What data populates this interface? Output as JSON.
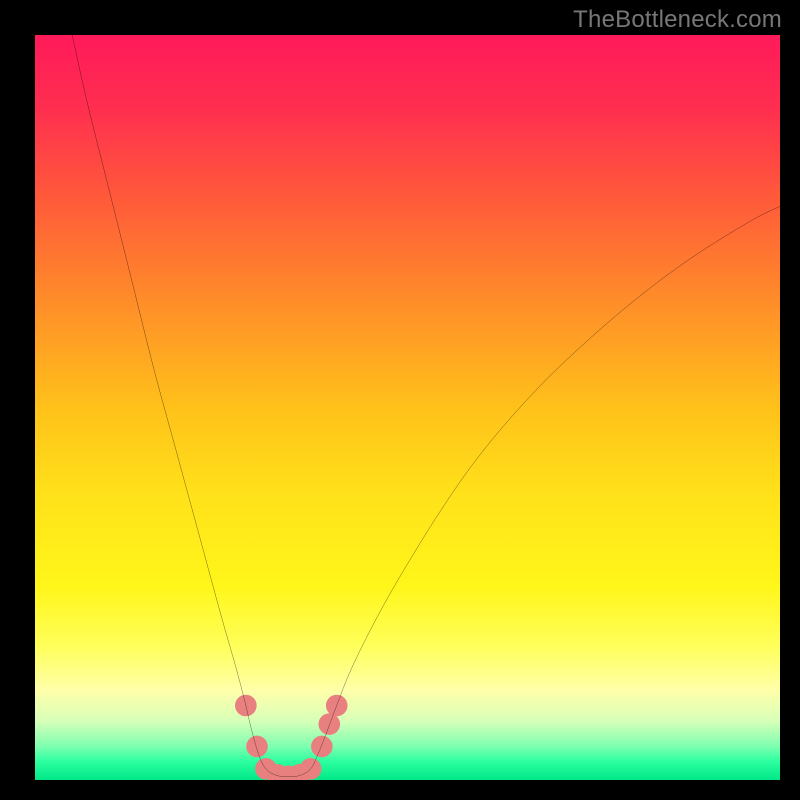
{
  "watermark": {
    "text": "TheBottleneck.com"
  },
  "gradient": {
    "stops": [
      {
        "offset": 0.0,
        "color": "#ff1a5a"
      },
      {
        "offset": 0.1,
        "color": "#ff2f4f"
      },
      {
        "offset": 0.22,
        "color": "#ff5a3a"
      },
      {
        "offset": 0.35,
        "color": "#ff8a2a"
      },
      {
        "offset": 0.5,
        "color": "#ffc11a"
      },
      {
        "offset": 0.62,
        "color": "#ffe21a"
      },
      {
        "offset": 0.74,
        "color": "#fff61a"
      },
      {
        "offset": 0.82,
        "color": "#ffff5a"
      },
      {
        "offset": 0.88,
        "color": "#ffffaa"
      },
      {
        "offset": 0.92,
        "color": "#d8ffb8"
      },
      {
        "offset": 0.955,
        "color": "#7dffb0"
      },
      {
        "offset": 0.975,
        "color": "#2dffa0"
      },
      {
        "offset": 1.0,
        "color": "#00e888"
      }
    ]
  },
  "chart_data": {
    "type": "line",
    "title": "",
    "xlabel": "",
    "ylabel": "",
    "xlim": [
      0,
      100
    ],
    "ylim": [
      0,
      100
    ],
    "series": [
      {
        "name": "bottleneck-curve",
        "style": "thin-black",
        "points": [
          {
            "x": 5.0,
            "y": 100.0
          },
          {
            "x": 7.0,
            "y": 91.0
          },
          {
            "x": 10.0,
            "y": 79.0
          },
          {
            "x": 13.0,
            "y": 67.0
          },
          {
            "x": 16.0,
            "y": 55.0
          },
          {
            "x": 19.0,
            "y": 44.0
          },
          {
            "x": 22.0,
            "y": 33.0
          },
          {
            "x": 25.0,
            "y": 22.0
          },
          {
            "x": 27.0,
            "y": 15.0
          },
          {
            "x": 28.3,
            "y": 10.0
          },
          {
            "x": 29.0,
            "y": 7.0
          },
          {
            "x": 30.0,
            "y": 3.5
          },
          {
            "x": 31.0,
            "y": 1.5
          },
          {
            "x": 32.5,
            "y": 0.6
          },
          {
            "x": 34.0,
            "y": 0.5
          },
          {
            "x": 35.5,
            "y": 0.6
          },
          {
            "x": 37.0,
            "y": 1.5
          },
          {
            "x": 38.0,
            "y": 3.5
          },
          {
            "x": 39.0,
            "y": 6.0
          },
          {
            "x": 40.5,
            "y": 10.0
          },
          {
            "x": 42.5,
            "y": 15.0
          },
          {
            "x": 46.0,
            "y": 22.0
          },
          {
            "x": 50.0,
            "y": 29.0
          },
          {
            "x": 55.0,
            "y": 37.0
          },
          {
            "x": 60.0,
            "y": 44.0
          },
          {
            "x": 66.0,
            "y": 51.0
          },
          {
            "x": 72.0,
            "y": 57.0
          },
          {
            "x": 80.0,
            "y": 64.0
          },
          {
            "x": 88.0,
            "y": 70.0
          },
          {
            "x": 96.0,
            "y": 75.0
          },
          {
            "x": 100.0,
            "y": 77.0
          }
        ]
      },
      {
        "name": "data-markers",
        "style": "salmon-dots",
        "points": [
          {
            "x": 28.3,
            "y": 10.0
          },
          {
            "x": 29.8,
            "y": 4.5
          },
          {
            "x": 31.0,
            "y": 1.5
          },
          {
            "x": 32.5,
            "y": 0.7
          },
          {
            "x": 34.0,
            "y": 0.5
          },
          {
            "x": 35.5,
            "y": 0.7
          },
          {
            "x": 37.0,
            "y": 1.5
          },
          {
            "x": 38.5,
            "y": 4.5
          },
          {
            "x": 39.5,
            "y": 7.5
          },
          {
            "x": 40.5,
            "y": 10.0
          }
        ]
      }
    ]
  }
}
